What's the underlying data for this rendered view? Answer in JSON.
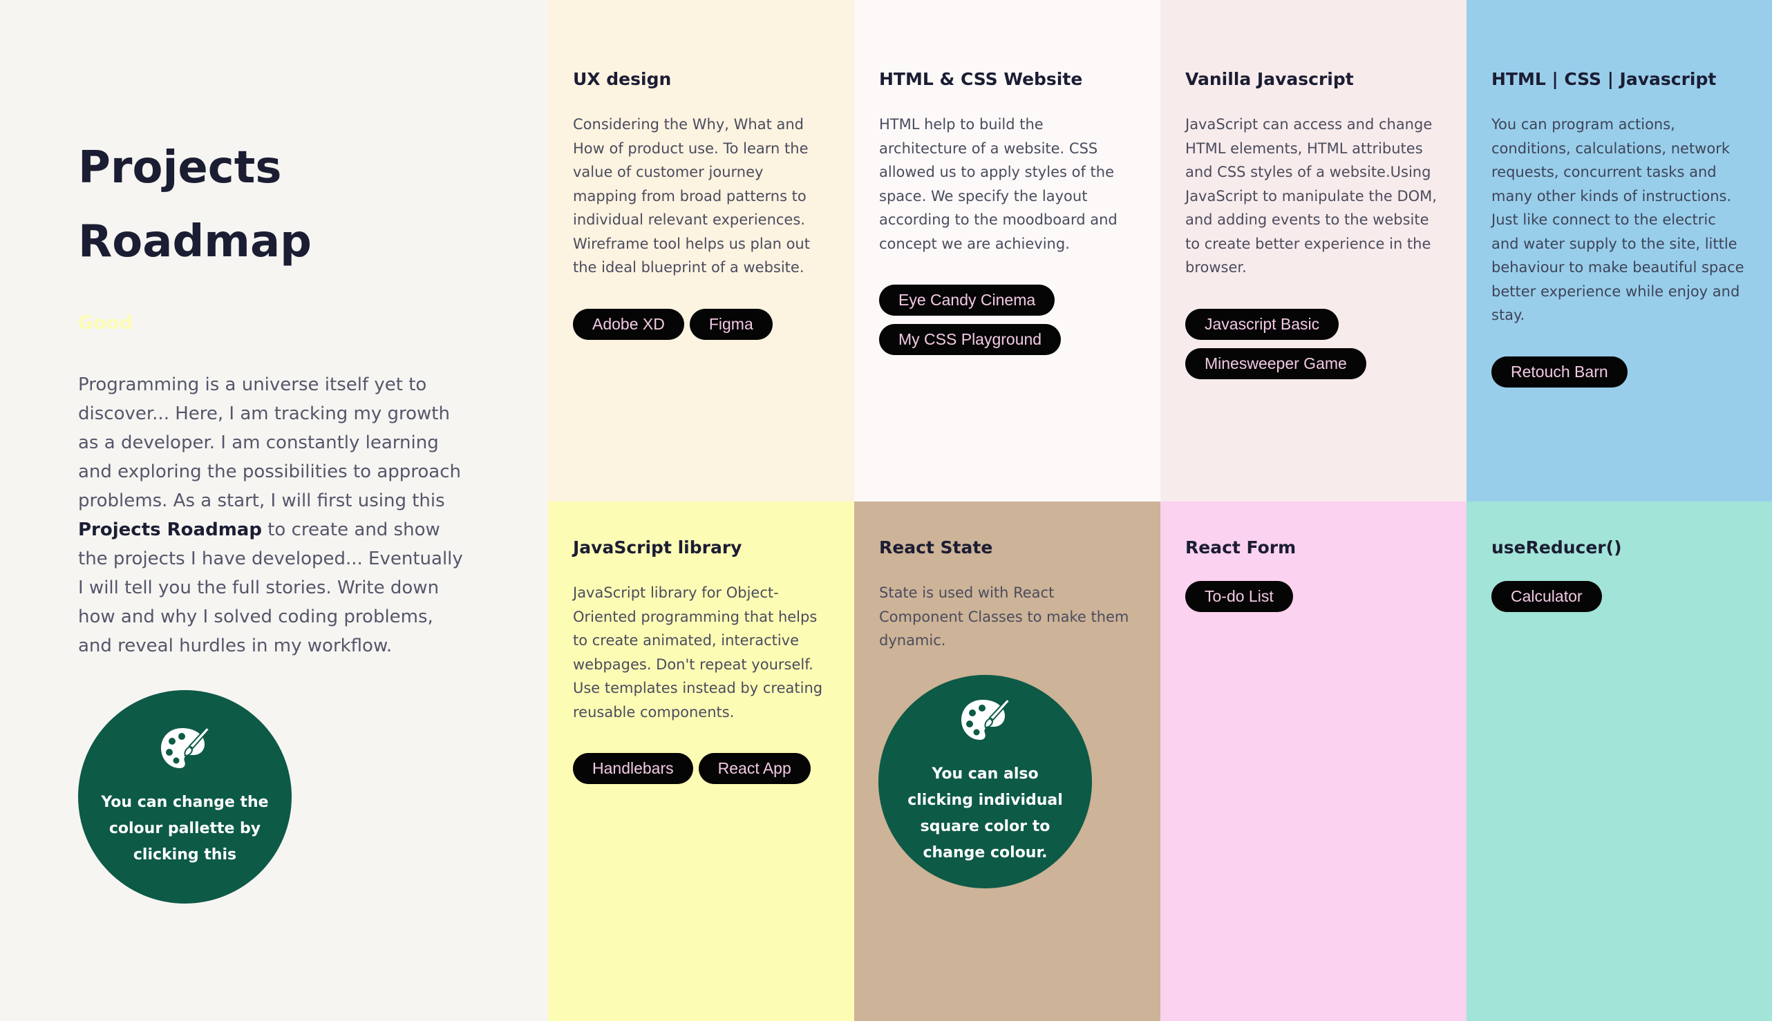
{
  "intro": {
    "title": "Projects Roadmap",
    "mood": "Good",
    "text_before": "Programming is a universe itself yet to discover... Here, I am tracking my growth as a developer. I am constantly learning and exploring the possibilities to approach problems. As a start, I will first using this ",
    "text_bold": "Projects Roadmap",
    "text_after": " to create and show the projects I have developed... Eventually I will tell you the full stories. Write down how and why I solved coding problems, and reveal hurdles in my workflow.",
    "bubble_text": "You can change the colour pallette by clicking this",
    "bubble_icon": "palette-icon"
  },
  "cards": [
    {
      "title": "UX design",
      "description": "Considering the Why, What and How of product use. To learn the value of customer journey mapping from broad patterns to individual relevant experiences. Wireframe tool helps us plan out the ideal blueprint of a website.",
      "tags": [
        "Adobe XD",
        "Figma"
      ],
      "color": "#fdf3e1"
    },
    {
      "title": "HTML & CSS Website",
      "description": "HTML help to build the architecture of a website. CSS allowed us to apply styles of the space. We specify the layout according to the moodboard and concept we are achieving.",
      "tags": [
        "Eye Candy Cinema",
        "My CSS Playground"
      ],
      "color": "#fcf9f8"
    },
    {
      "title": "Vanilla Javascript",
      "description": "JavaScript can access and change HTML elements, HTML attributes and CSS styles of a website.Using JavaScript to manipulate the DOM, and adding events to the website to create better experience in the browser.",
      "tags": [
        "Javascript Basic",
        "Minesweeper Game"
      ],
      "color": "#f8ebeb"
    },
    {
      "title": "HTML | CSS | Javascript",
      "description": "You can program actions, conditions, calculations, network requests, concurrent tasks and many other kinds of instructions. Just like connect to the electric and water supply to the site, little behaviour to make beautiful space better experience while enjoy and stay.",
      "tags": [
        "Retouch Barn"
      ],
      "color": "#99ceeb"
    },
    {
      "title": "JavaScript library",
      "description": "JavaScript library for Object-Oriented programming that helps to create animated, interactive webpages. Don't repeat yourself. Use templates instead by creating reusable components.",
      "tags": [
        "Handlebars",
        "React App"
      ],
      "color": "#fdfcb5"
    },
    {
      "title": "React State",
      "description": "State is used with React Component Classes to make them dynamic.",
      "tags": [],
      "bubble_text": "You can also clicking individual square color to change colour.",
      "color": "#cdb397"
    },
    {
      "title": "React Form",
      "description": "",
      "tags": [
        "To-do List"
      ],
      "color": "#fbd2ef"
    },
    {
      "title": "useReducer()",
      "description": "",
      "tags": [
        "Calculator"
      ],
      "color": "#a2e4d8"
    }
  ]
}
